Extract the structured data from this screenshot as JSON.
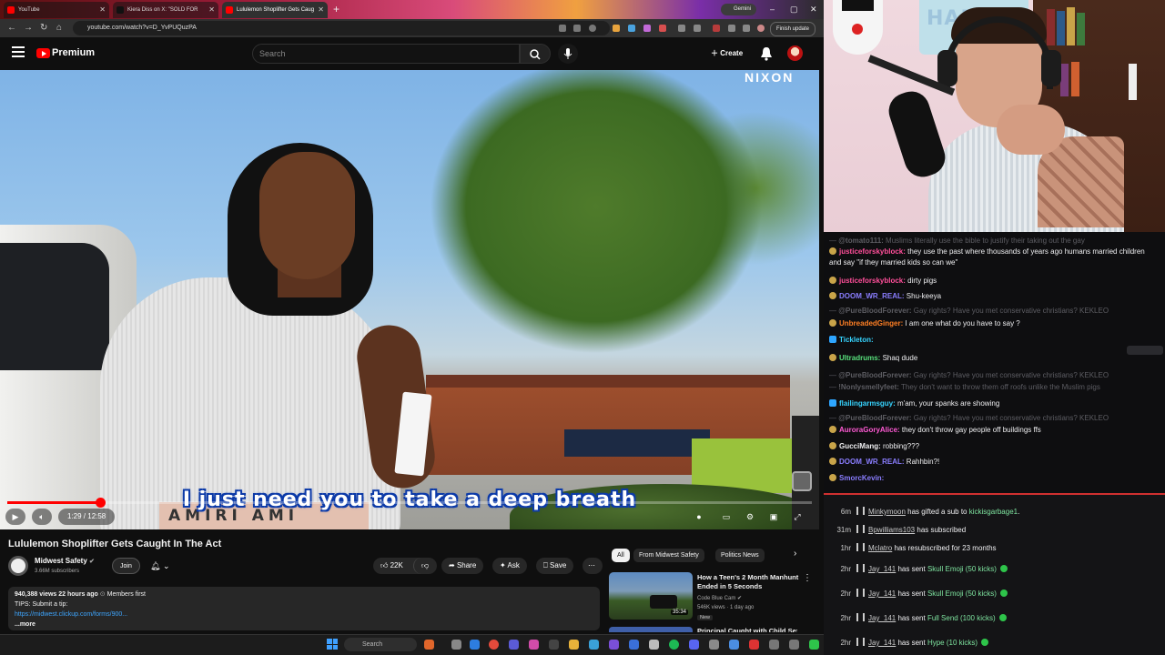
{
  "browser": {
    "tabs": [
      {
        "label": "YouTube",
        "favicon_color": "#ff0000",
        "active": false
      },
      {
        "label": "Kiera Diss on X: \"SOLD FOR",
        "favicon_color": "#111111",
        "active": false
      },
      {
        "label": "Lululemon Shoplifter Gets Caug",
        "favicon_color": "#ff0000",
        "active": true
      }
    ],
    "gemini_label": "Gemini",
    "url": "youtube.com/watch?v=D_YvPUQuzPA",
    "finish_update_label": "Finish update"
  },
  "youtube": {
    "brand": "Premium",
    "search_placeholder": "Search",
    "create_label": "Create",
    "video": {
      "watermark": "NIXON",
      "caption": "I just need you to take a deep breath",
      "shirt_text": "AMIRI   AMI",
      "time_current": "1:29",
      "time_total": "12:58",
      "time_display": "1:29 / 12:58",
      "progress_fraction": 0.115
    },
    "title": "Lululemon Shoplifter Gets Caught In The Act",
    "channel": {
      "name": "Midwest Safety",
      "subscribers": "3.66M subscribers"
    },
    "join_label": "Join",
    "actions": {
      "likes": "22K",
      "share": "Share",
      "ask": "Ask",
      "save": "Save"
    },
    "description": {
      "stats": "940,388 views  22 hours ago",
      "members": "Members first",
      "line2": "TIPS: Submit a tip:",
      "link": "https://midwest.clickup.com/forms/900...",
      "more": "...more"
    },
    "chips": [
      "All",
      "From Midwest Safety",
      "Politics News"
    ],
    "recommended": [
      {
        "title": "How a Teen's 2 Month Manhunt Ended in 5 Seconds",
        "channel": "Code Blue Cam",
        "meta": "546K views · 1 day ago",
        "badge": "New",
        "duration": "35:34"
      },
      {
        "title": "Principal Caught with Child Sex"
      }
    ]
  },
  "taskbar": {
    "search_label": "Search"
  },
  "webcam": {
    "poster_text": "HAPPY EAS"
  },
  "chat": [
    {
      "user": "@tomato111:",
      "text": "Muslims literally use the bible to justify their taking out the gay",
      "faded": true,
      "user_color": ""
    },
    {
      "user": "justiceforskyblock:",
      "text": "they use the past where thousands of years ago humans married children and say \"if they married kids so can we\"",
      "faded": false,
      "user_color": "#ff4f9a"
    },
    {
      "user": "justiceforskyblock:",
      "text": "dirty pigs",
      "faded": false,
      "user_color": "#ff4f9a"
    },
    {
      "user": "DOOM_WR_REAL:",
      "text": "Shu-keeya",
      "faded": false,
      "user_color": "#8a7dff"
    },
    {
      "user": "@PureBloodForever:",
      "text": "Gay rights? Have you met conservative christians? KEKLEO",
      "faded": true,
      "user_color": ""
    },
    {
      "user": "UnbreadedGinger:",
      "text": "I am one what do you have to say ?",
      "faded": false,
      "user_color": "#ff7f24"
    },
    {
      "user": "Tickleton:",
      "text": "",
      "faded": false,
      "user_color": "#36d4ff"
    },
    {
      "user": "Ultradrums:",
      "text": "Shaq dude",
      "faded": false,
      "user_color": "#58e07c"
    },
    {
      "user": "@PureBloodForever:",
      "text": "Gay rights? Have you met conservative christians? KEKLEO",
      "faded": true,
      "user_color": ""
    },
    {
      "user": "!Nonlysmellyfeet:",
      "text": "They don't want to throw them off roofs unlike the Muslim pigs",
      "faded": true,
      "user_color": ""
    },
    {
      "user": "flailingarmsguy:",
      "text": "m'am, your spanks are showing",
      "faded": false,
      "user_color": "#36d4ff"
    },
    {
      "user": "@PureBloodForever:",
      "text": "Gay rights? Have you met conservative christians? KEKLEO",
      "faded": true,
      "user_color": ""
    },
    {
      "user": "AuroraGoryAlice:",
      "text": "they don't throw gay people off buildings ffs",
      "faded": false,
      "user_color": "#ff5ad4"
    },
    {
      "user": "GucciMang:",
      "text": "robbing???",
      "faded": false,
      "user_color": "#efeff1"
    },
    {
      "user": "DOOM_WR_REAL:",
      "text": "Rahhbin?!",
      "faded": false,
      "user_color": "#8a7dff"
    },
    {
      "user": "SmorcKevin:",
      "text": "",
      "faded": false,
      "user_color": "#8a7dff"
    }
  ],
  "events": [
    {
      "time": "6m",
      "who": "Minkymoon",
      "pre": "",
      "mid": " has gifted a sub to ",
      "target": "kickisgarbage1",
      "post": ".",
      "gem": false
    },
    {
      "time": "31m",
      "who": "Bpwilliams103",
      "pre": "",
      "mid": " has subscribed",
      "target": "",
      "post": "",
      "gem": false
    },
    {
      "time": "1hr",
      "who": "Mclatro",
      "pre": "",
      "mid": " has resubscribed for 23 months",
      "target": "",
      "post": "",
      "gem": false
    },
    {
      "time": "2hr",
      "who": "Jay_141",
      "pre": "",
      "mid": " has sent ",
      "target": "Skull Emoji (50 kicks)",
      "post": "",
      "gem": true
    },
    {
      "time": "2hr",
      "who": "Jay_141",
      "pre": "",
      "mid": " has sent ",
      "target": "Skull Emoji (50 kicks)",
      "post": "",
      "gem": true
    },
    {
      "time": "2hr",
      "who": "Jay_141",
      "pre": "",
      "mid": " has sent ",
      "target": "Full Send (100 kicks)",
      "post": "",
      "gem": true
    },
    {
      "time": "2hr",
      "who": "Jay_141",
      "pre": "",
      "mid": " has sent ",
      "target": "Hype (10 kicks)",
      "post": "",
      "gem": true
    }
  ]
}
